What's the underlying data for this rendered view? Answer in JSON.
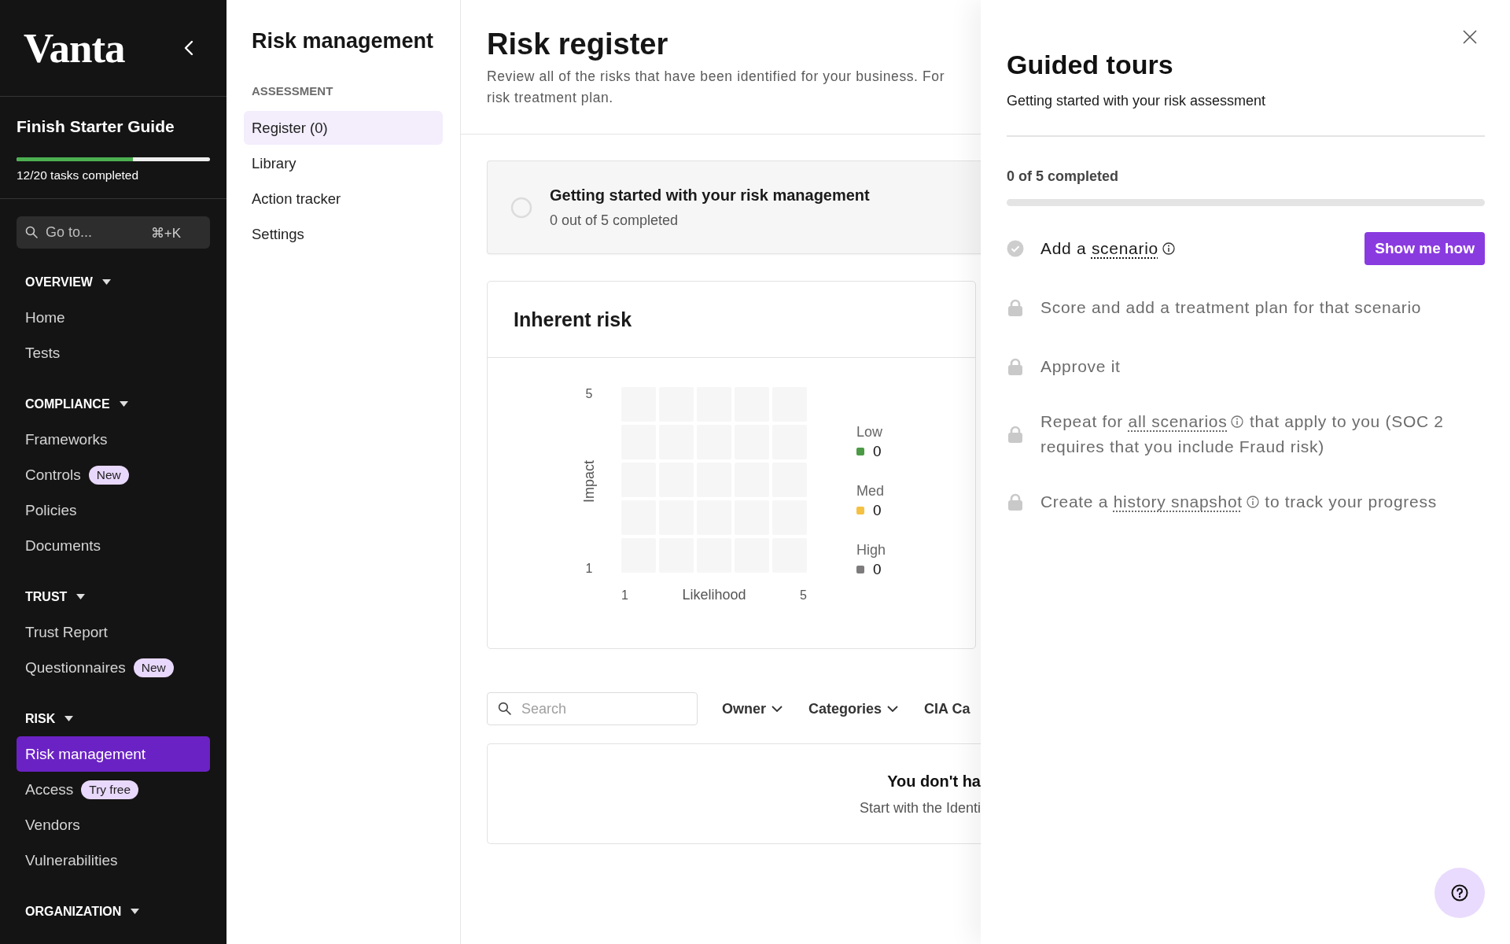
{
  "sidebar": {
    "logo": "Vanta",
    "starter_guide": {
      "title": "Finish Starter Guide",
      "level": 0.6,
      "progress_text": "12/20 tasks completed"
    },
    "search": {
      "placeholder": "Go to...",
      "shortcut": "⌘+K"
    },
    "sections": [
      {
        "title": "OVERVIEW",
        "expanded": true,
        "items": [
          {
            "label": "Home",
            "selected": false
          },
          {
            "label": "Tests",
            "selected": false
          }
        ]
      },
      {
        "title": "COMPLIANCE",
        "expanded": true,
        "items": [
          {
            "label": "Frameworks",
            "selected": false
          },
          {
            "label": "Controls",
            "selected": false,
            "badge": "New"
          },
          {
            "label": "Policies",
            "selected": false
          },
          {
            "label": "Documents",
            "selected": false
          }
        ]
      },
      {
        "title": "TRUST",
        "expanded": true,
        "items": [
          {
            "label": "Trust Report",
            "selected": false
          },
          {
            "label": "Questionnaires",
            "selected": false,
            "badge": "New"
          }
        ]
      },
      {
        "title": "RISK",
        "expanded": true,
        "items": [
          {
            "label": "Risk management",
            "selected": true
          },
          {
            "label": "Access",
            "selected": false,
            "badge": "Try free"
          },
          {
            "label": "Vendors",
            "selected": false
          },
          {
            "label": "Vulnerabilities",
            "selected": false
          }
        ]
      },
      {
        "title": "ORGANIZATION",
        "expanded": true
      }
    ]
  },
  "subnav": {
    "title": "Risk management",
    "group": "ASSESSMENT",
    "items": [
      {
        "label": "Register (0)",
        "selected": true
      },
      {
        "label": "Library",
        "selected": false
      },
      {
        "label": "Action tracker",
        "selected": false
      },
      {
        "label": "Settings",
        "selected": false
      }
    ]
  },
  "main": {
    "title": "Risk register",
    "description_lines": [
      "Review all of the risks that have been identified for your business. For",
      "risk treatment plan."
    ],
    "guide_card": {
      "title": "Getting started with your risk management",
      "progress": "0 out of 5 completed",
      "level": 0
    },
    "inherent_risk": {
      "title": "Inherent risk",
      "y_axis": {
        "label": "Impact",
        "max": "5",
        "min": "1"
      },
      "x_axis": {
        "label": "Likelihood",
        "min": "1",
        "max": "5"
      },
      "legend": [
        {
          "label": "Low",
          "count": "0",
          "color": "#4c9a45"
        },
        {
          "label": "Med",
          "count": "0",
          "color": "#f4c143"
        },
        {
          "label": "High",
          "count": "0",
          "color": "#7d7b7b"
        }
      ]
    },
    "filters": {
      "search_placeholder": "Search",
      "dropdowns": [
        {
          "label": "Owner",
          "caret": true
        },
        {
          "label": "Categories",
          "caret": true
        },
        {
          "label": "CIA Ca",
          "caret": false
        }
      ]
    },
    "empty_state": {
      "title": "You don't ha",
      "text": "Start with the Identi"
    }
  },
  "guided_tour": {
    "title": "Guided tours",
    "subtitle": "Getting started with your risk assessment",
    "progress_text": "0 of 5 completed",
    "steps": [
      {
        "locked": false,
        "parts": [
          {
            "text": "Add a "
          },
          {
            "text": "scenario",
            "kind": "term"
          }
        ],
        "button": "Show me how"
      },
      {
        "locked": true,
        "parts": [
          {
            "text": "Score and add a treatment plan for that scenario"
          }
        ]
      },
      {
        "locked": true,
        "parts": [
          {
            "text": "Approve it"
          }
        ]
      },
      {
        "locked": true,
        "parts": [
          {
            "text": "Repeat for "
          },
          {
            "text": "all scenarios",
            "kind": "term"
          },
          {
            "text": " that apply to you (SOC 2 requires that you include Fraud risk)"
          }
        ]
      },
      {
        "locked": true,
        "parts": [
          {
            "text": "Create a "
          },
          {
            "text": "history snapshot",
            "kind": "term"
          },
          {
            "text": " to track your progress"
          }
        ]
      }
    ]
  }
}
